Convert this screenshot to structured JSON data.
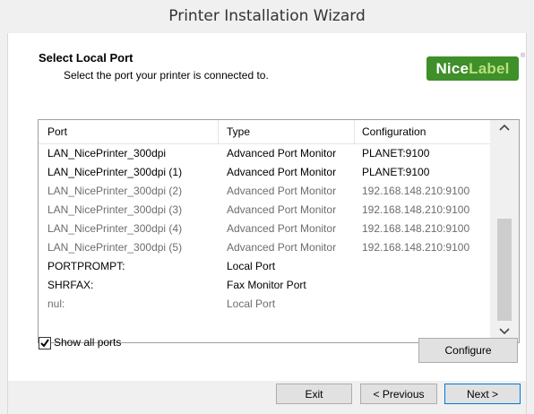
{
  "window": {
    "title": "Printer Installation Wizard"
  },
  "header": {
    "title": "Select Local Port",
    "subtitle": "Select the port your printer is connected to.",
    "logo_text_1": "Nice",
    "logo_text_2": "Label",
    "logo_reg": "®"
  },
  "ports": {
    "columns": [
      "Port",
      "Type",
      "Configuration"
    ],
    "rows": [
      {
        "port": "LAN_NicePrinter_300dpi",
        "type": "Advanced Port Monitor",
        "config": "PLANET:9100",
        "dim": false
      },
      {
        "port": "LAN_NicePrinter_300dpi (1)",
        "type": "Advanced Port Monitor",
        "config": "PLANET:9100",
        "dim": false
      },
      {
        "port": "LAN_NicePrinter_300dpi (2)",
        "type": "Advanced Port Monitor",
        "config": "192.168.148.210:9100",
        "dim": true
      },
      {
        "port": "LAN_NicePrinter_300dpi (3)",
        "type": "Advanced Port Monitor",
        "config": "192.168.148.210:9100",
        "dim": true
      },
      {
        "port": "LAN_NicePrinter_300dpi (4)",
        "type": "Advanced Port Monitor",
        "config": "192.168.148.210:9100",
        "dim": true
      },
      {
        "port": "LAN_NicePrinter_300dpi (5)",
        "type": "Advanced Port Monitor",
        "config": "192.168.148.210:9100",
        "dim": true
      },
      {
        "port": "PORTPROMPT:",
        "type": "Local Port",
        "config": "",
        "dim": false
      },
      {
        "port": "SHRFAX:",
        "type": "Fax Monitor Port",
        "config": "",
        "dim": false
      },
      {
        "port": "nul:",
        "type": "Local Port",
        "config": "",
        "dim": true
      }
    ],
    "scroll_up_icon": "chevron-up-icon",
    "scroll_down_icon": "chevron-down-icon"
  },
  "options": {
    "show_all_ports_label": "Show all ports",
    "show_all_ports_checked": true
  },
  "buttons": {
    "configure": "Configure",
    "exit": "Exit",
    "previous": "< Previous",
    "next": "Next >"
  },
  "colors": {
    "logo_bg": "#3f8f2a",
    "logo_accent": "#b8e07a",
    "dim_text": "#6d6d6d",
    "next_border": "#0078d7"
  }
}
